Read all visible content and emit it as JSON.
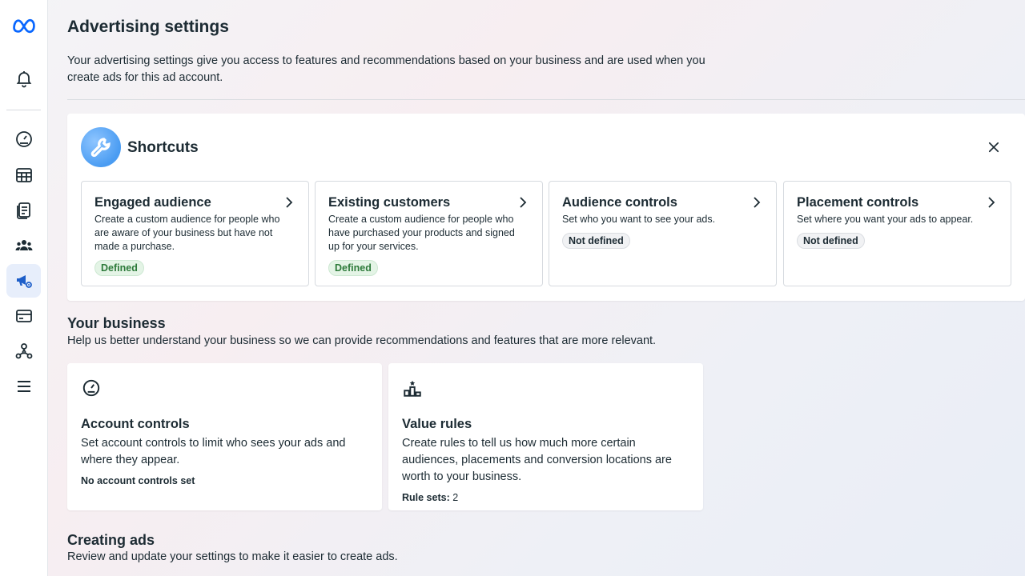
{
  "sidebar": {
    "items": [
      {
        "name": "meta-logo"
      },
      {
        "name": "notifications"
      },
      {
        "name": "overview"
      },
      {
        "name": "campaigns"
      },
      {
        "name": "reporting"
      },
      {
        "name": "audiences"
      },
      {
        "name": "advertising-settings",
        "active": true
      },
      {
        "name": "billing"
      },
      {
        "name": "events-manager"
      },
      {
        "name": "all-tools"
      }
    ]
  },
  "page": {
    "title": "Advertising settings",
    "description": "Your advertising settings give you access to features and recommendations based on your business and are used when you create ads for this ad account."
  },
  "shortcuts": {
    "title": "Shortcuts",
    "cards": [
      {
        "title": "Engaged audience",
        "description": "Create a custom audience for people who are aware of your business but have not made a purchase.",
        "status": "Defined"
      },
      {
        "title": "Existing customers",
        "description": "Create a custom audience for people who have purchased your products and signed up for your services.",
        "status": "Defined"
      },
      {
        "title": "Audience controls",
        "description": "Set who you want to see your ads.",
        "status": "Not defined"
      },
      {
        "title": "Placement controls",
        "description": "Set where you want your ads to appear.",
        "status": "Not defined"
      }
    ]
  },
  "your_business": {
    "title": "Your business",
    "description": "Help us better understand your business so we can provide recommendations and features that are more relevant.",
    "cards": [
      {
        "title": "Account controls",
        "description": "Set account controls to limit who sees your ads and where they appear.",
        "status": "No account controls set"
      },
      {
        "title": "Value rules",
        "description": "Create rules to tell us how much more certain audiences, placements and conversion locations are worth to your business.",
        "status_label": "Rule sets:",
        "status_value": "2"
      }
    ]
  },
  "creating_ads": {
    "title": "Creating ads",
    "description": "Review and update your settings to make it easier to create ads."
  },
  "colors": {
    "meta_blue": "#0866ff",
    "defined_bg": "#e4f4e6",
    "defined_text": "#2d7a3a",
    "active_nav_bg": "#e7eefb"
  }
}
